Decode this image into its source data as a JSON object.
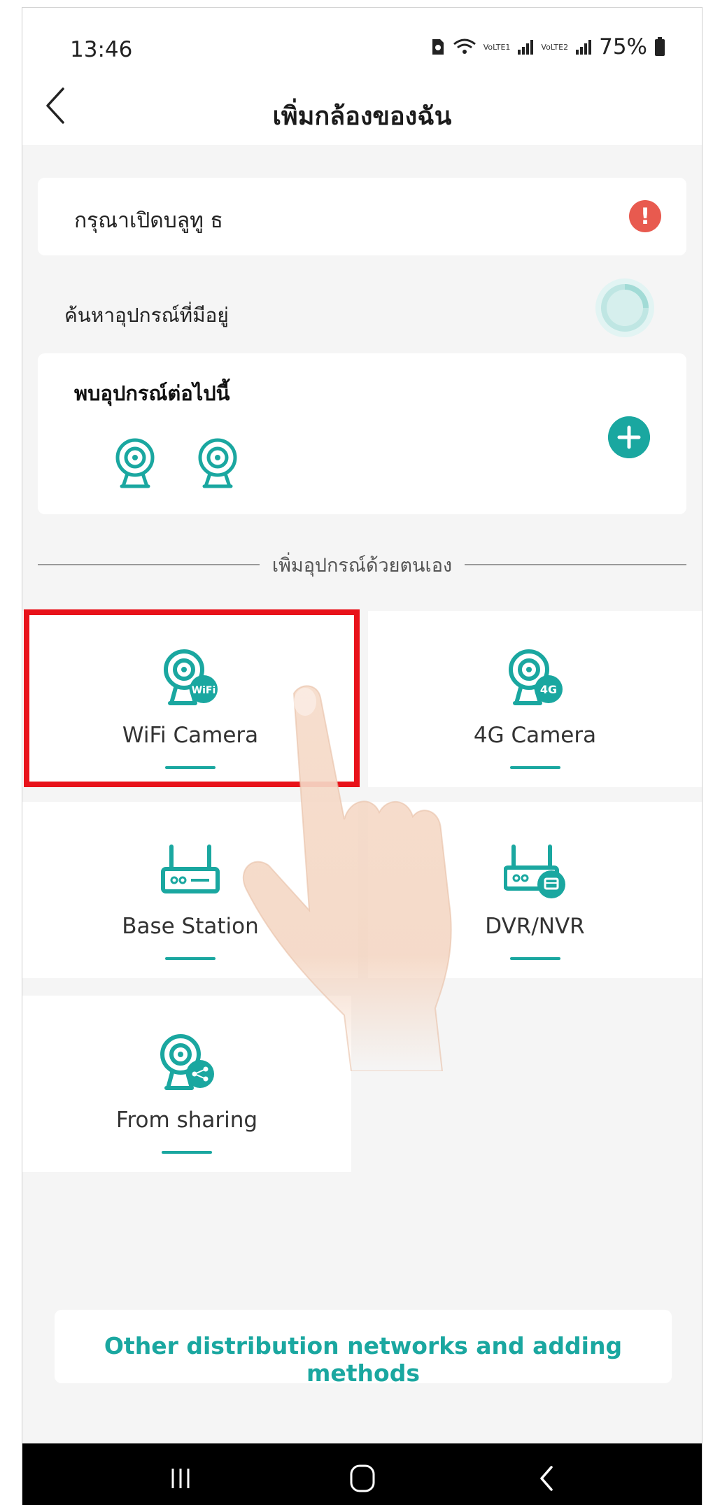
{
  "status": {
    "time": "13:46",
    "battery": "75%",
    "net1": "VoLTE1",
    "net2": "VoLTE2"
  },
  "header": {
    "title": "เพิ่มกล้องของฉัน"
  },
  "bluetooth": {
    "label": "กรุณาเปิดบลูทู ธ",
    "alert_icon": "!"
  },
  "search": {
    "label": "ค้นหาอุปกรณ์ที่มีอยู่"
  },
  "found": {
    "title": "พบอุปกรณ์ต่อไปนี้"
  },
  "manual": {
    "divider_label": "เพิ่มอุปกรณ์ด้วยตนเอง"
  },
  "tiles": [
    {
      "label": "WiFi Camera",
      "badge": "WiFi"
    },
    {
      "label": "4G Camera",
      "badge": "4G"
    },
    {
      "label": "Base Station"
    },
    {
      "label": "DVR/NVR"
    },
    {
      "label": "From sharing"
    }
  ],
  "bottom": {
    "link_label": "Other distribution networks and adding methods"
  },
  "colors": {
    "accent": "#1aa7a0",
    "alert": "#e85a4f",
    "highlight": "#e8121a"
  }
}
